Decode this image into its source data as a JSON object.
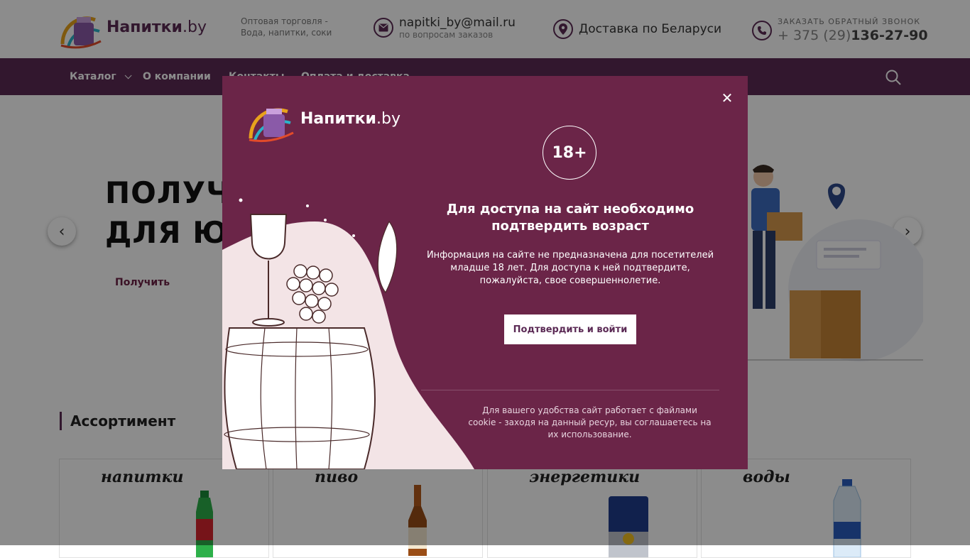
{
  "header": {
    "logo_text": "Напитки",
    "logo_tld": ".by",
    "tagline": "Оптовая торговля - Вода, напитки, соки",
    "email": "napitki_by@mail.ru",
    "email_sub": "по вопросам заказов",
    "delivery": "Доставка по Беларуси",
    "callback_label": "ЗАКАЗАТЬ ОБРАТНЫЙ ЗВОНОК",
    "phone_prefix": "+ 375 (29)",
    "phone_number": "136-27-90"
  },
  "nav": {
    "items": [
      "Каталог",
      "О компании",
      "Контакты",
      "Оплата и доставка"
    ],
    "search_icon": "search-icon"
  },
  "hero": {
    "title_line1": "ПОЛУЧИ",
    "title_line2": "ДЛЯ ЮР",
    "link": "Получить",
    "prev": "‹",
    "next": "›"
  },
  "assortment": {
    "title": "Ассортимент",
    "cards": [
      "напитки",
      "пиво",
      "энергетики",
      "воды"
    ]
  },
  "modal": {
    "logo_text": "Напитки",
    "logo_tld": ".by",
    "age": "18+",
    "heading": "Для доступа на сайт необходимо подтвердить возраст",
    "text": "Информация на сайте не предназначена для посетителей младше 18 лет. Для доступа к ней подтвердите, пожалуйста, свое совершеннолетие.",
    "confirm": "Подтвердить и войти",
    "cookie": "Для вашего удобства сайт работает с файлами cookie - заходя на данный ресур, вы соглашаетесь на их использование.",
    "close": "✕"
  },
  "colors": {
    "brand": "#5b2a55",
    "modal_bg": "#6b2548",
    "accent_link": "#6c2246"
  }
}
